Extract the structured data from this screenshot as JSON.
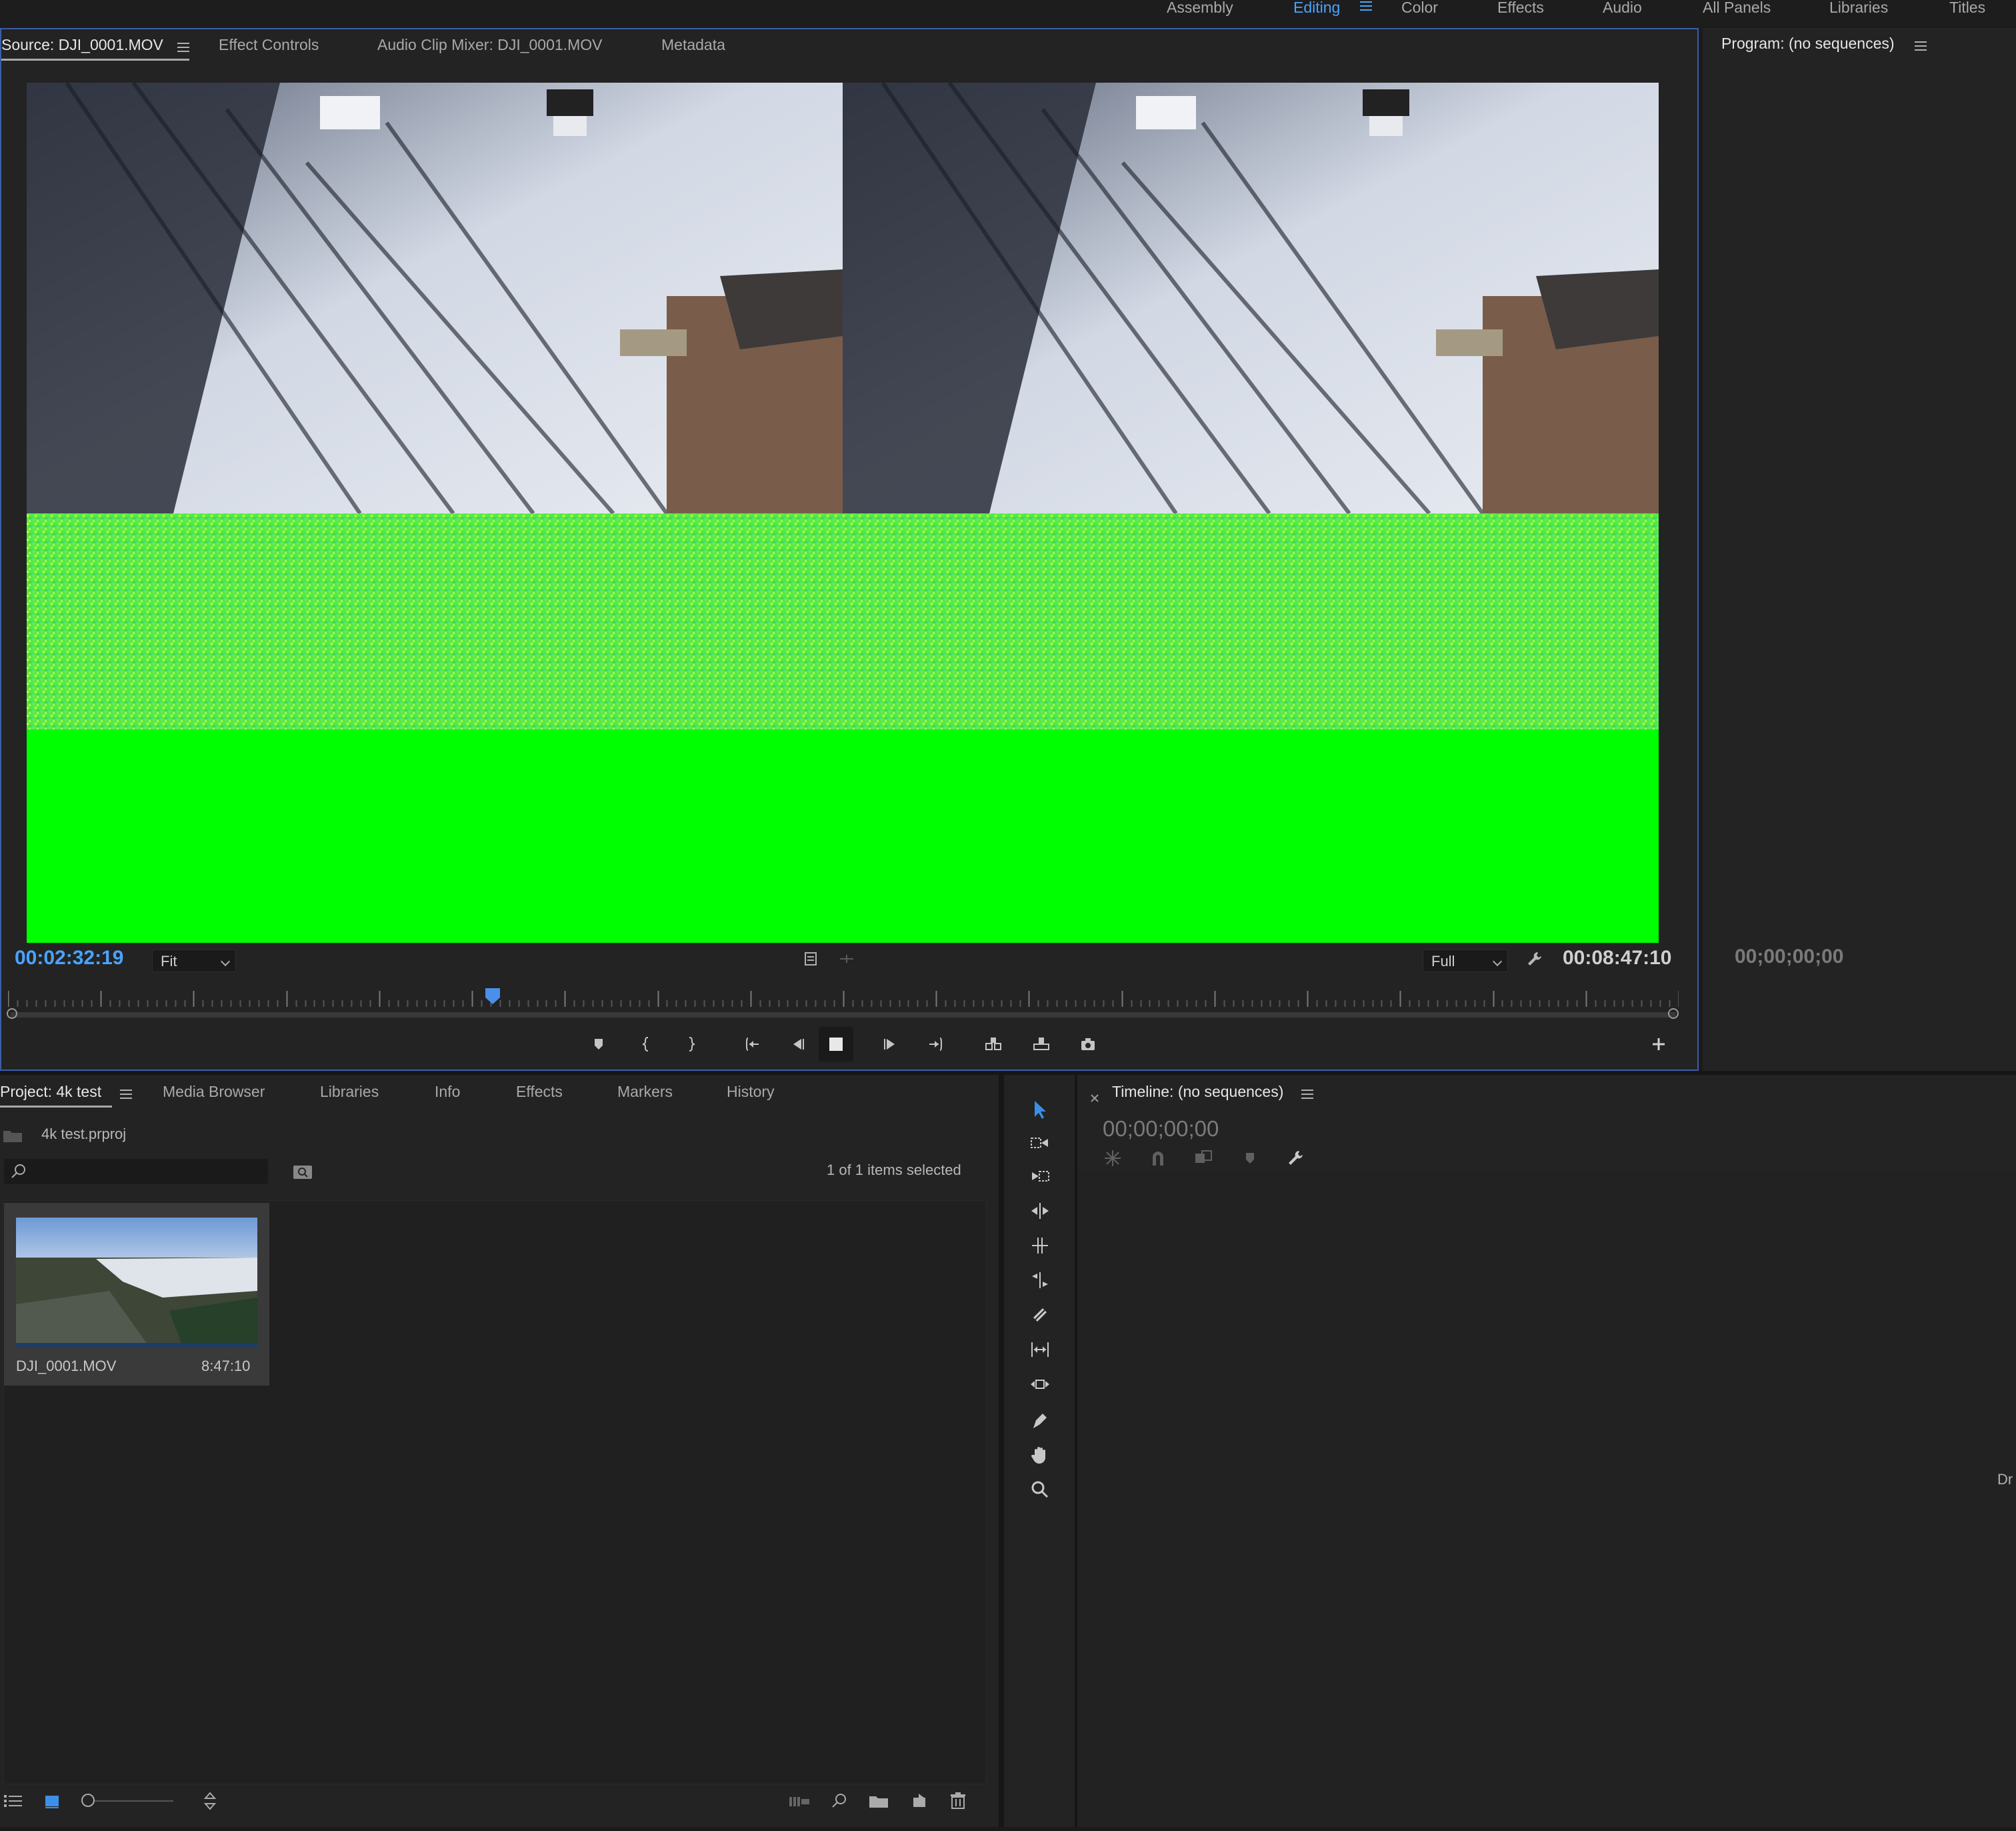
{
  "workspaces": {
    "items": [
      {
        "label": "Assembly",
        "active": false
      },
      {
        "label": "Editing",
        "active": true
      },
      {
        "label": "Color",
        "active": false
      },
      {
        "label": "Effects",
        "active": false
      },
      {
        "label": "Audio",
        "active": false
      },
      {
        "label": "All Panels",
        "active": false
      },
      {
        "label": "Libraries",
        "active": false
      },
      {
        "label": "Titles",
        "active": false
      }
    ]
  },
  "source_panel": {
    "tabs": [
      {
        "label": "Source: DJI_0001.MOV",
        "active": true
      },
      {
        "label": "Effect Controls",
        "active": false
      },
      {
        "label": "Audio Clip Mixer: DJI_0001.MOV",
        "active": false
      },
      {
        "label": "Metadata",
        "active": false
      }
    ],
    "current_time": "00:02:32:19",
    "zoom_select": "Fit",
    "resolution_select": "Full",
    "duration": "00:08:47:10",
    "playhead_fraction": 0.29,
    "accent_color": "#4aa3ff",
    "green_color": "#00ff00"
  },
  "program_panel": {
    "title": "Program: (no sequences)",
    "timecode": "00;00;00;00"
  },
  "project_panel": {
    "tabs": [
      {
        "label": "Project: 4k test",
        "active": true
      },
      {
        "label": "Media Browser",
        "active": false
      },
      {
        "label": "Libraries",
        "active": false
      },
      {
        "label": "Info",
        "active": false
      },
      {
        "label": "Effects",
        "active": false
      },
      {
        "label": "Markers",
        "active": false
      },
      {
        "label": "History",
        "active": false
      }
    ],
    "project_file": "4k test.prproj",
    "search_value": "",
    "selection_status": "1 of 1 items selected",
    "items": [
      {
        "name": "DJI_0001.MOV",
        "duration": "8:47:10"
      }
    ]
  },
  "timeline_panel": {
    "title": "Timeline: (no sequences)",
    "timecode": "00;00;00;00",
    "edge_text": "Dr"
  },
  "icons": {
    "source_controls": [
      "add-marker-icon",
      "mark-in-icon",
      "mark-out-icon",
      "go-to-in-icon",
      "step-back-icon",
      "stop-icon",
      "step-forward-icon",
      "go-to-out-icon",
      "insert-icon",
      "overwrite-icon",
      "export-frame-icon"
    ],
    "tools": [
      "selection-tool-icon",
      "track-select-forward-icon",
      "track-select-backward-icon",
      "ripple-edit-icon",
      "rolling-edit-icon",
      "rate-stretch-icon",
      "razor-icon",
      "slip-icon",
      "slide-icon",
      "pen-icon",
      "hand-icon",
      "zoom-icon"
    ]
  }
}
